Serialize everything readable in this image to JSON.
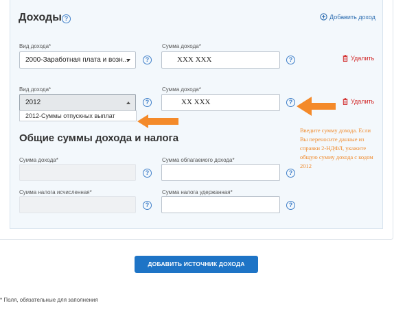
{
  "income_section": {
    "title": "Доходы",
    "add_income_label": "Добавить доход",
    "delete_label": "Удалить",
    "row1": {
      "type_label": "Вид дохода*",
      "type_value": "2000-Заработная плата и возн...",
      "amount_label": "Сумма дохода*",
      "amount_value": "ХХХ ХХХ"
    },
    "row2": {
      "type_label": "Вид дохода*",
      "type_value": "2012",
      "dropdown_option": "2012-Суммы отпускных выплат",
      "amount_label": "Сумма дохода*",
      "amount_value": "ХХ ХХХ"
    }
  },
  "totals_section": {
    "title": "Общие суммы дохода и налога",
    "total_income_label": "Сумма дохода*",
    "taxable_income_label": "Сумма облагаемого дохода*",
    "tax_calculated_label": "Сумма налога исчисленная*",
    "tax_withheld_label": "Сумма налога удержанная*"
  },
  "annotation": {
    "text": "Введите сумму дохода. Если Вы переносите данные из справки 2-НДФЛ, укажите общую сумму дохода с кодом 2012",
    "color": "#f08a2c"
  },
  "add_source_button": "ДОБАВИТЬ ИСТОЧНИК ДОХОДА",
  "footnote": "* Поля, обязательные для заполнения",
  "help_glyph": "?",
  "colors": {
    "accent": "#1e74c6",
    "delete": "#d22c2c",
    "arrow": "#f48a2a"
  }
}
